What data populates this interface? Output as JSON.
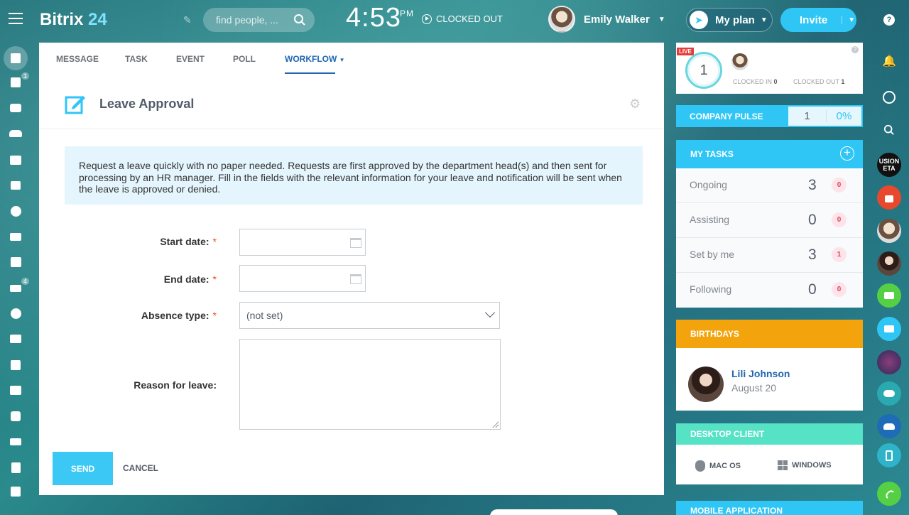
{
  "header": {
    "app_name": "Bitrix",
    "app_num": "24",
    "search_placeholder": "find people, ...",
    "time": "4:53",
    "ampm": "PM",
    "clock_status": "CLOCKED OUT",
    "user_name": "Emily Walker",
    "myplan_label": "My plan",
    "invite_label": "Invite"
  },
  "left_sidebar": {
    "badges": {
      "tasks": "1",
      "filter": "4"
    },
    "icons": [
      "feed-icon",
      "tasks-icon",
      "chat-icon",
      "employees-icon",
      "contact-center-icon",
      "crm-icon",
      "time-icon",
      "mail-icon",
      "calendar-icon",
      "filter-icon",
      "goals-icon",
      "shop-icon",
      "apps-icon",
      "sites-icon",
      "telephony-icon",
      "inventory-icon",
      "documents-icon",
      "schedule-icon"
    ]
  },
  "composer": {
    "tabs": [
      "MESSAGE",
      "TASK",
      "EVENT",
      "POLL",
      "WORKFLOW"
    ],
    "active_tab": "WORKFLOW",
    "title": "Leave Approval",
    "info_text": "Request a leave quickly with no paper needed. Requests are first approved by the department head(s) and then sent for processing by an HR manager. Fill in the fields with the relevant information for your leave and notification will be sent when the leave is approved or denied.",
    "fields": {
      "start_date": {
        "label": "Start date:",
        "value": ""
      },
      "end_date": {
        "label": "End date:",
        "value": ""
      },
      "absence_type": {
        "label": "Absence type:",
        "value": "(not set)"
      },
      "reason": {
        "label": "Reason for leave:",
        "value": ""
      }
    },
    "required_mark": "*",
    "send_label": "SEND",
    "cancel_label": "CANCEL"
  },
  "right_panel": {
    "live": {
      "badge": "LIVE",
      "count": "1",
      "clocked_in_label": "CLOCKED IN",
      "clocked_in_value": "0",
      "clocked_out_label": "CLOCKED OUT",
      "clocked_out_value": "1",
      "help": "?"
    },
    "pulse": {
      "label": "COMPANY PULSE",
      "value": "1",
      "percent": "0%"
    },
    "tasks": {
      "title": "MY TASKS",
      "rows": [
        {
          "label": "Ongoing",
          "count": "3",
          "badge": "0"
        },
        {
          "label": "Assisting",
          "count": "0",
          "badge": "0"
        },
        {
          "label": "Set by me",
          "count": "3",
          "badge": "1"
        },
        {
          "label": "Following",
          "count": "0",
          "badge": "0"
        }
      ]
    },
    "birthdays": {
      "title": "BIRTHDAYS",
      "name": "Lili Johnson",
      "date": "August 20"
    },
    "desktop": {
      "title": "DESKTOP CLIENT",
      "mac": "MAC OS",
      "windows": "WINDOWS"
    },
    "mobile": {
      "title": "MOBILE APPLICATION"
    }
  },
  "right_bar": {
    "help": "?",
    "fusion_label": "USION ETA",
    "colors": {
      "lock": "#e8482d",
      "video": "#55d044",
      "cloud": "#2fc6f6",
      "group": "#1e6bb8",
      "phone": "#55d044"
    }
  }
}
